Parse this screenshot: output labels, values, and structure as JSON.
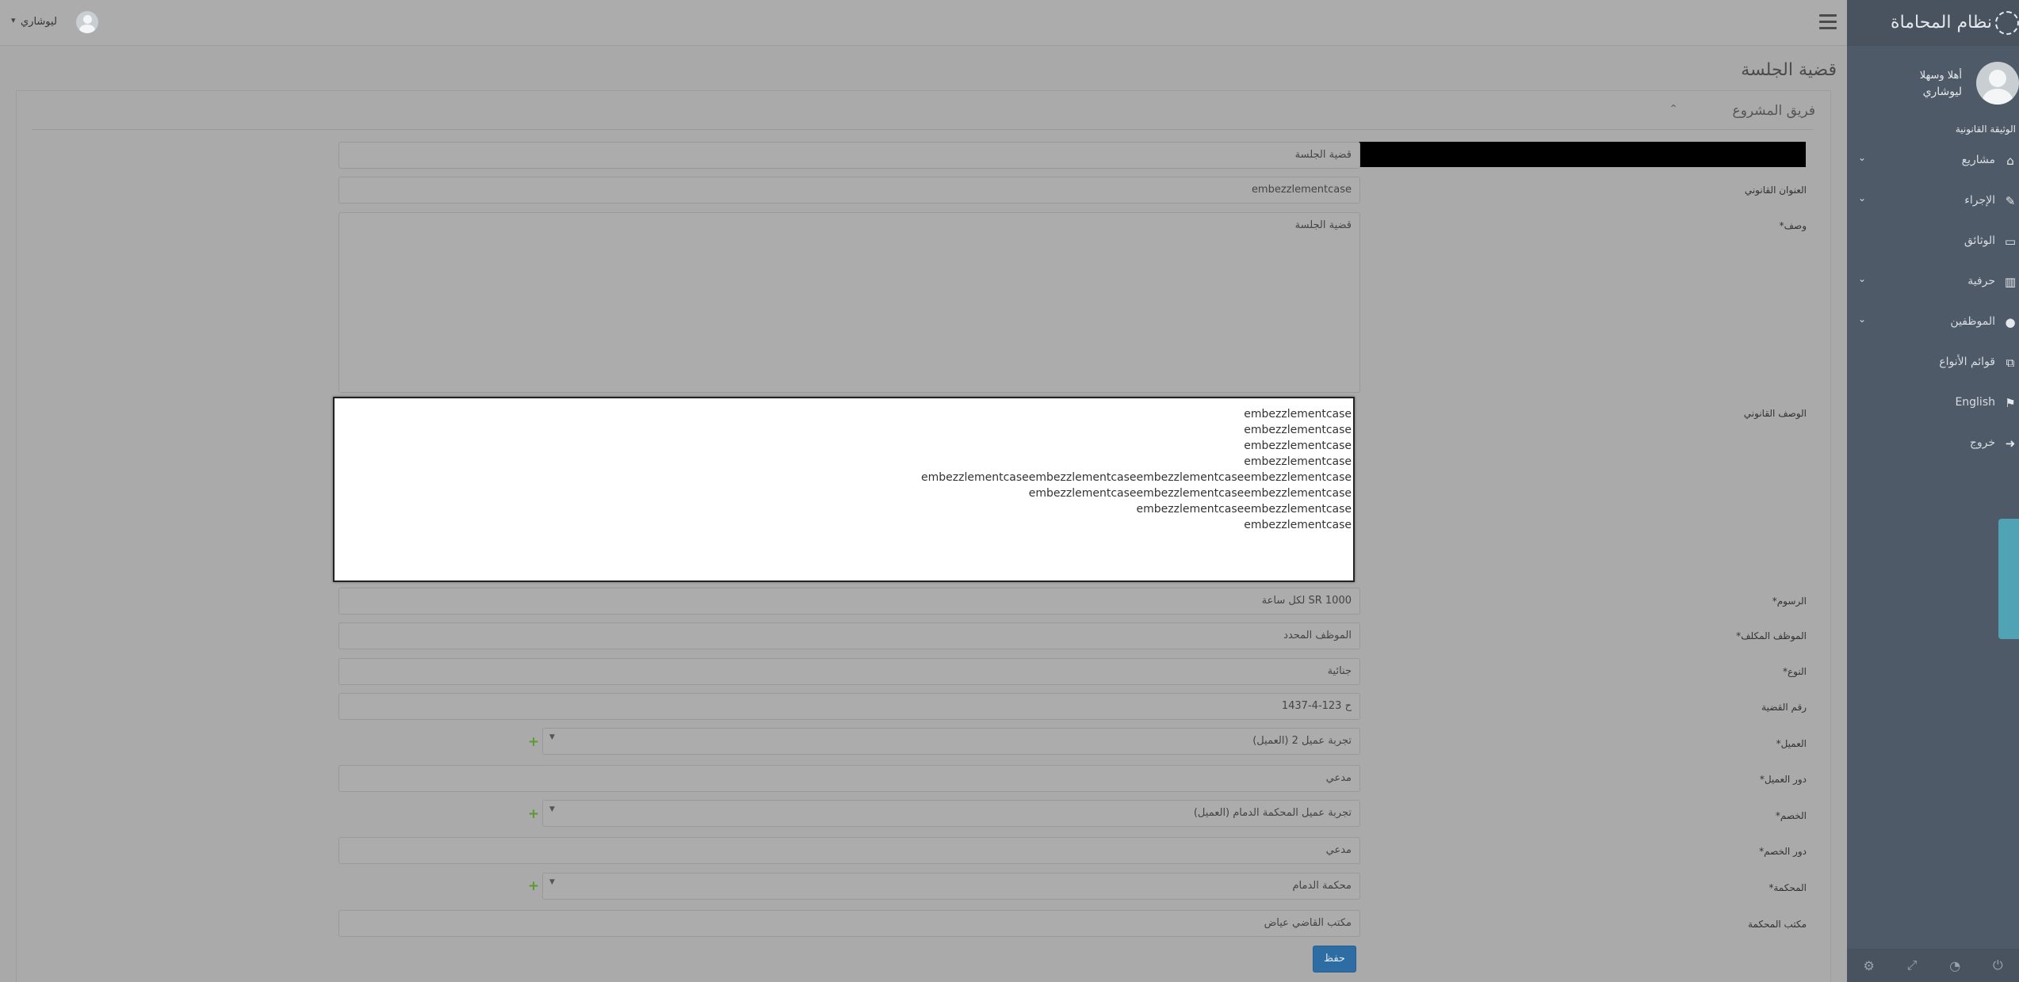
{
  "app": {
    "title": "نظام المحاماة"
  },
  "sidebar": {
    "greeting": "أهلا وسهلا",
    "user_name": "ليوشاري",
    "subtitle": "الوثيقة القانونية",
    "items": [
      {
        "label": "مشاريع",
        "icon": "home-icon",
        "has_children": true
      },
      {
        "label": "الإجراء",
        "icon": "edit-icon",
        "has_children": true
      },
      {
        "label": "الوثائق",
        "icon": "monitor-icon",
        "has_children": false
      },
      {
        "label": "حرفية",
        "icon": "bar-chart-icon",
        "has_children": true
      },
      {
        "label": "الموظفين",
        "icon": "user-icon",
        "has_children": true
      },
      {
        "label": "قوائم الأنواع",
        "icon": "copy-icon",
        "has_children": false
      },
      {
        "label": "English",
        "icon": "language-icon",
        "has_children": false
      },
      {
        "label": "خروج",
        "icon": "sign-out-icon",
        "has_children": false
      }
    ],
    "accent_color": "#4fa3b5"
  },
  "topbar": {
    "user_name": "ليوشاري"
  },
  "page": {
    "title": "قضية الجلسة",
    "panel_title": "فريق المشروع"
  },
  "form": {
    "name_value": "قضية الجلسة",
    "legal_title_label": "العنوان القانوني",
    "legal_title_value": "embezzlementcase",
    "description_label": "وصف*",
    "description_value": "قضية الجلسة",
    "legal_description_label": "الوصف القانوني",
    "fee_label": "الرسوم*",
    "fee_value": "1000 SR لكل ساعة",
    "employee_label": "الموظف المكلف*",
    "employee_value": "الموظف المحدد",
    "type_label": "النوع*",
    "type_value": "جنائية",
    "case_number_label": "رقم القضية",
    "case_number_value": "ح 123-4-1437",
    "client_label": "العميل*",
    "client_value": "تجربة عميل 2 (العميل)",
    "client_role_label": "دور العميل*",
    "client_role_value": "مدعي",
    "opponent_label": "الخصم*",
    "opponent_value": "تجربة عميل المحكمة الدمام (العميل)",
    "opponent_role_label": "دور الخصم*",
    "opponent_role_value": "مدعي",
    "court_label": "المحكمة*",
    "court_value": "محكمة الدمام",
    "court_office_label": "مكتب المحكمة",
    "court_office_value": "مكتب القاضي عياض",
    "save_label": "حفظ"
  },
  "popup_lines": [
    "embezzlementcase",
    "embezzlementcase",
    "embezzlementcase",
    "embezzlementcase",
    "embezzlementcaseembezzlementcaseembezzlementcaseembezzlementcase",
    "embezzlementcaseembezzlementcaseembezzlementcase",
    "embezzlementcaseembezzlementcase",
    "embezzlementcase"
  ]
}
